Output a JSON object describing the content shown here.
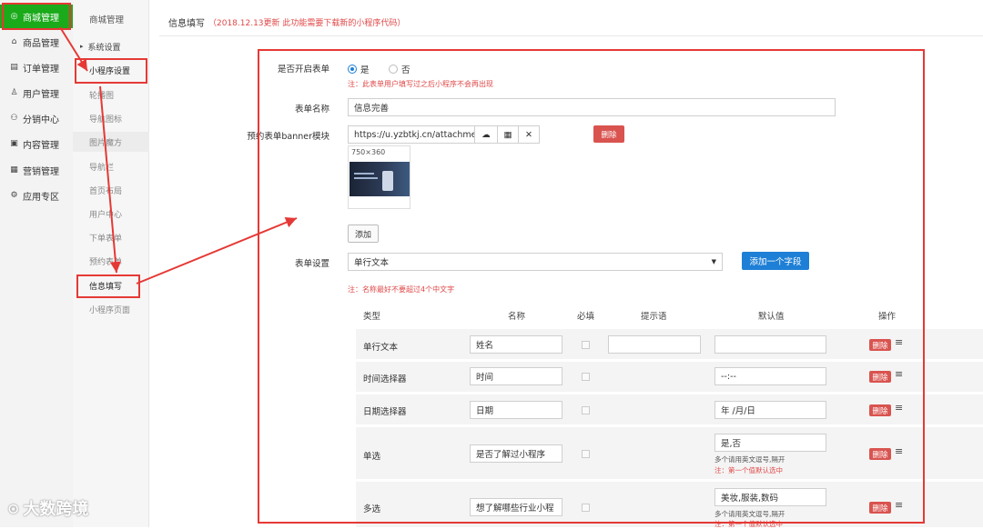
{
  "sidebar": {
    "items": [
      {
        "label": "商城管理",
        "icon": "shop-icon"
      },
      {
        "label": "商品管理",
        "icon": "product-icon"
      },
      {
        "label": "订单管理",
        "icon": "order-icon"
      },
      {
        "label": "用户管理",
        "icon": "user-icon"
      },
      {
        "label": "分销中心",
        "icon": "distribution-icon"
      },
      {
        "label": "内容管理",
        "icon": "content-icon"
      },
      {
        "label": "营销管理",
        "icon": "marketing-icon"
      },
      {
        "label": "应用专区",
        "icon": "apps-icon"
      }
    ]
  },
  "subnav": {
    "title": "商城管理",
    "group": "系统设置",
    "items": [
      "小程序设置",
      "轮播图",
      "导航图标",
      "图片魔方",
      "导航栏",
      "首页布局",
      "用户中心",
      "下单表单",
      "预约表单",
      "信息填写",
      "小程序页面"
    ]
  },
  "header": {
    "title": "信息填写",
    "notice": "（2018.12.13更新 此功能需要下载新的小程序代码）"
  },
  "form": {
    "enable_label": "是否开启表单",
    "opt_yes": "是",
    "opt_no": "否",
    "enable_note": "注：此表单用户填写过之后小程序不会再出现",
    "name_label": "表单名称",
    "name_value": "信息完善",
    "banner_label": "预约表单banner模块",
    "banner_url": "https://u.yzbtkj.cn/attachmen",
    "delete": "删除",
    "image_size": "750×360",
    "add": "添加",
    "settings_label": "表单设置",
    "field_type_selected": "单行文本",
    "add_field": "添加一个字段",
    "settings_note": "注：名称最好不要超过4个中文字"
  },
  "table": {
    "headers": [
      "类型",
      "名称",
      "必填",
      "提示语",
      "默认值",
      "操作"
    ],
    "rows": [
      {
        "type": "单行文本",
        "name": "姓名",
        "hint": "",
        "default": ""
      },
      {
        "type": "时间选择器",
        "name": "时间",
        "default": "--:--"
      },
      {
        "type": "日期选择器",
        "name": "日期",
        "default": "年 /月/日"
      },
      {
        "type": "单选",
        "name": "是否了解过小程序",
        "default": "是,否",
        "note1": "多个请用英文逗号,隔开",
        "note2": "注：第一个值默认选中"
      },
      {
        "type": "多选",
        "name": "想了解哪些行业小程",
        "default": "美妆,服装,数码",
        "note1": "多个请用英文逗号,隔开",
        "note2": "注：第一个值默认选中"
      }
    ],
    "delete": "删除"
  },
  "watermark": "大数跨境",
  "colors": {
    "accent": "#1aaa1a",
    "primary": "#1e7fd6",
    "danger": "#d9534f",
    "annotation": "#e53935"
  }
}
